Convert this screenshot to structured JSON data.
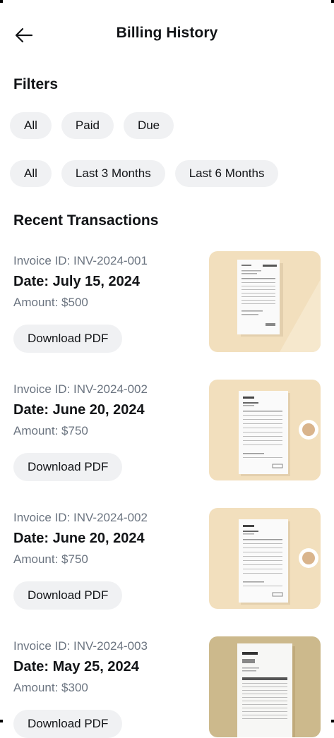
{
  "header": {
    "title": "Billing History",
    "back_icon": "arrow-left-icon"
  },
  "filters": {
    "title": "Filters",
    "status_options": [
      "All",
      "Paid",
      "Due"
    ],
    "period_options": [
      "All",
      "Last 3 Months",
      "Last 6 Months"
    ]
  },
  "recent": {
    "title": "Recent Transactions",
    "items": [
      {
        "invoice_id": "Invoice ID: INV-2024-001",
        "date": "Date: July 15, 2024",
        "amount": "Amount: $500",
        "button": "Download PDF",
        "thumbnail_icon": "invoice-document-icon"
      },
      {
        "invoice_id": "Invoice ID: INV-2024-002",
        "date": "Date: June 20, 2024",
        "amount": "Amount: $750",
        "button": "Download PDF",
        "thumbnail_icon": "invoice-document-icon"
      },
      {
        "invoice_id": "Invoice ID: INV-2024-002",
        "date": "Date: June 20, 2024",
        "amount": "Amount: $750",
        "button": "Download PDF",
        "thumbnail_icon": "invoice-document-icon"
      },
      {
        "invoice_id": "Invoice ID: INV-2024-003",
        "date": "Date: May 25, 2024",
        "amount": "Amount: $300",
        "button": "Download PDF",
        "thumbnail_icon": "invoice-document-icon"
      }
    ]
  },
  "colors": {
    "text_primary": "#121417",
    "text_secondary": "#6b7480",
    "chip_background": "#f0f1f3",
    "thumbnail_cream": "#f2dfbd",
    "thumbnail_khaki": "#ccb98c"
  }
}
